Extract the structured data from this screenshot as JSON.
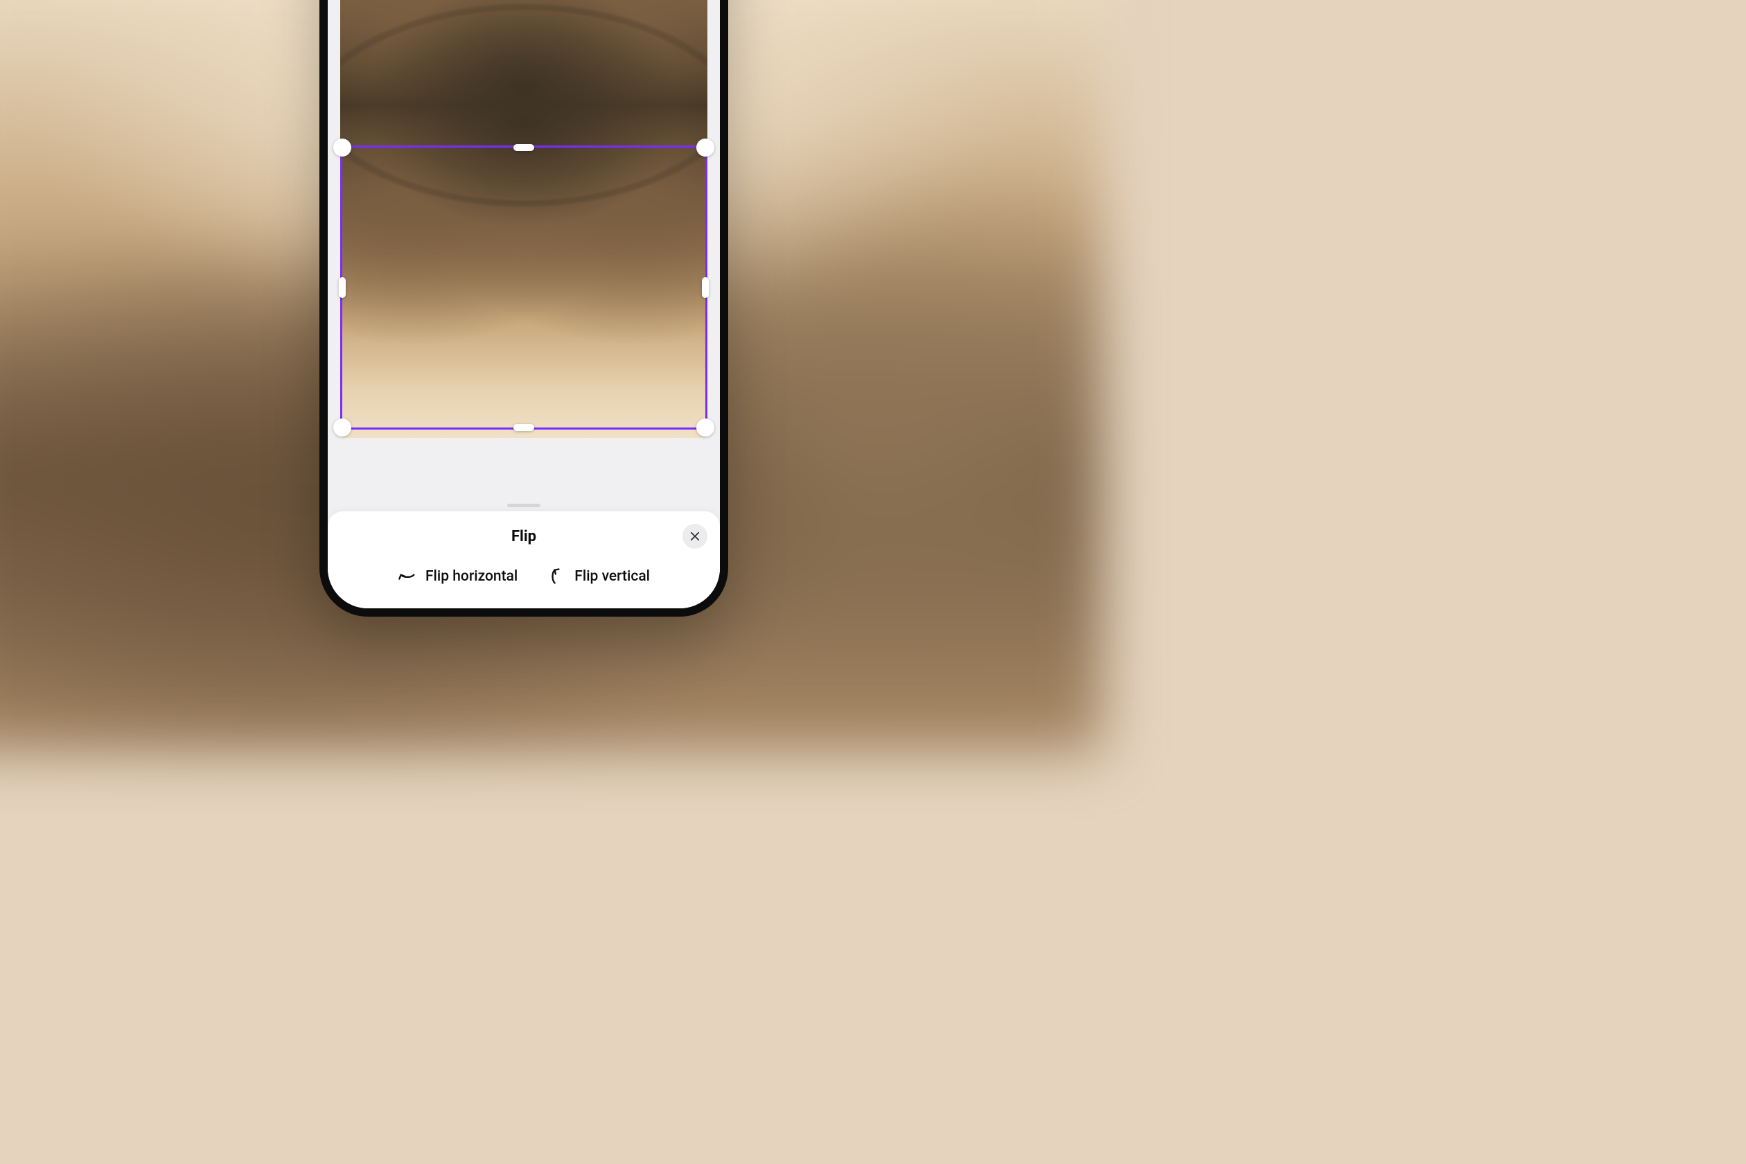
{
  "sheet": {
    "title": "Flip",
    "close_icon": "close-icon",
    "actions": {
      "horizontal": {
        "label": "Flip horizontal",
        "icon": "flip-horizontal-icon"
      },
      "vertical": {
        "label": "Flip vertical",
        "icon": "flip-vertical-icon"
      }
    }
  },
  "selection": {
    "accent_color": "#7a2cff"
  }
}
